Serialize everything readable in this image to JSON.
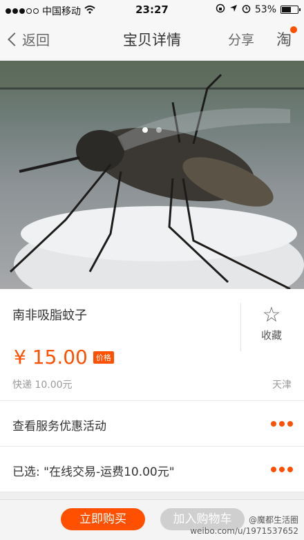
{
  "status_bar": {
    "carrier": "中国移动",
    "time": "23:27",
    "battery": "53%"
  },
  "nav": {
    "back_label": "返回",
    "title": "宝贝详情",
    "share_label": "分享",
    "tao_glyph": "淘"
  },
  "gallery": {
    "image_subject": "mosquito",
    "page_count": 2,
    "active_page": 1
  },
  "product": {
    "name": "南非吸脂蚊子",
    "favorite_label": "收藏",
    "price": "¥ 15.00",
    "price_tag": "价格",
    "shipping": "快递 10.00元",
    "location": "天津"
  },
  "rows": {
    "service_label": "查看服务优惠活动",
    "selected_label": "已选: \"在线交易-运费10.00元\""
  },
  "actions": {
    "buy_label": "立即购买",
    "cart_label": "加入购物车"
  },
  "watermark": {
    "line1": "@魔都生活圈",
    "line2": "weibo.com/u/1971537652"
  },
  "colors": {
    "accent": "#ff5000"
  }
}
